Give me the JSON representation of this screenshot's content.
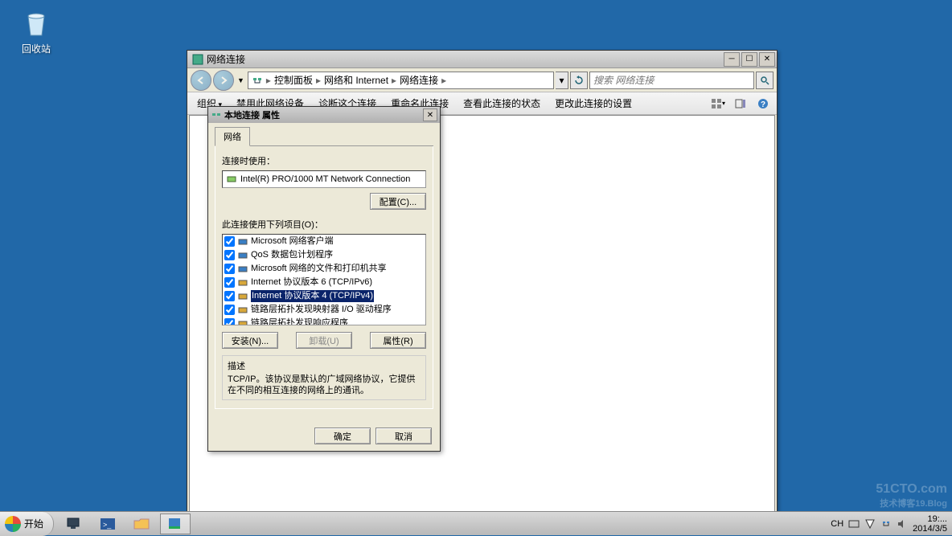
{
  "desktop": {
    "recycle_bin": "回收站"
  },
  "explorer": {
    "title": "网络连接",
    "breadcrumb": [
      "控制面板",
      "网络和 Internet",
      "网络连接"
    ],
    "search_placeholder": "搜索 网络连接",
    "toolbar": {
      "organize": "组织",
      "disable": "禁用此网络设备",
      "diagnose": "诊断这个连接",
      "rename": "重命名此连接",
      "status": "查看此连接的状态",
      "change": "更改此连接的设置"
    }
  },
  "dialog": {
    "title": "本地连接 属性",
    "tab_network": "网络",
    "connect_using": "连接时使用：",
    "adapter": "Intel(R) PRO/1000 MT Network Connection",
    "configure_btn": "配置(C)...",
    "items_label": "此连接使用下列项目(O)：",
    "items": [
      {
        "label": "Microsoft 网络客户端",
        "checked": true,
        "selected": false
      },
      {
        "label": "QoS 数据包计划程序",
        "checked": true,
        "selected": false
      },
      {
        "label": "Microsoft 网络的文件和打印机共享",
        "checked": true,
        "selected": false
      },
      {
        "label": "Internet 协议版本 6 (TCP/IPv6)",
        "checked": true,
        "selected": false
      },
      {
        "label": "Internet 协议版本 4 (TCP/IPv4)",
        "checked": true,
        "selected": true
      },
      {
        "label": "链路层拓扑发现映射器 I/O 驱动程序",
        "checked": true,
        "selected": false
      },
      {
        "label": "链路层拓扑发现响应程序",
        "checked": true,
        "selected": false
      }
    ],
    "install_btn": "安装(N)...",
    "uninstall_btn": "卸载(U)",
    "properties_btn": "属性(R)",
    "desc_title": "描述",
    "desc_text": "TCP/IP。该协议是默认的广域网络协议，它提供在不同的相互连接的网络上的通讯。",
    "ok_btn": "确定",
    "cancel_btn": "取消"
  },
  "taskbar": {
    "start": "开始",
    "lang": "CH",
    "time": "19:...",
    "date": "2014/3/5"
  },
  "watermark": {
    "line1": "51CTO.com",
    "line2": "技术博客19.Blog"
  }
}
